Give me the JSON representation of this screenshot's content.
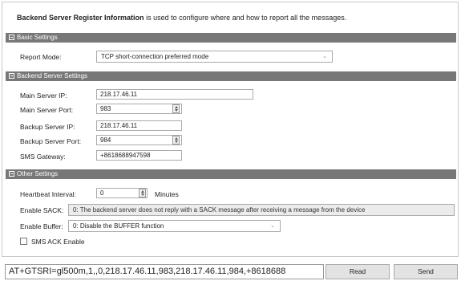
{
  "info": {
    "bold": "Backend Server Register Information",
    "rest": " is used to configure where and how to report all the messages."
  },
  "sections": {
    "basic": "Basic Settings",
    "backend": "Backend Server Settings",
    "other": "Other Settings"
  },
  "basic": {
    "report_mode_label": "Report Mode:",
    "report_mode_value": "TCP short-connection preferred mode"
  },
  "backend": {
    "main_ip_label": "Main Server IP:",
    "main_ip_value": "218.17.46.11",
    "main_port_label": "Main Server Port:",
    "main_port_value": "983",
    "backup_ip_label": "Backup Server IP:",
    "backup_ip_value": "218.17.46.11",
    "backup_port_label": "Backup Server Port:",
    "backup_port_value": "984",
    "sms_label": "SMS Gateway:",
    "sms_value": "+8618688947598"
  },
  "other": {
    "heartbeat_label": "Heartbeat Interval:",
    "heartbeat_value": "0",
    "heartbeat_unit": "Minutes",
    "sack_label": "Enable SACK:",
    "sack_value": "0: The backend server does not reply with a SACK message after receiving a message from the device",
    "buffer_label": "Enable Buffer:",
    "buffer_value": "0: Disable the BUFFER function",
    "sms_ack_label": "SMS ACK Enable",
    "sms_ack_checked": false
  },
  "command": {
    "value": "AT+GTSRI=gl500m,1,,0,218.17.46.11,983,218.17.46.11,984,+8618688"
  },
  "buttons": {
    "read": "Read",
    "send": "Send"
  },
  "icons": {
    "collapse": "collapse-box-icon",
    "dropdown": "chevron-down-icon",
    "spinner": "spinner-arrows-icon",
    "checkbox": "checkbox-icon"
  },
  "colors": {
    "section_bar": "#777777",
    "frame_border": "#c9c9c9",
    "button_bg": "#e3e3e3",
    "sack_bg": "#ececec"
  }
}
